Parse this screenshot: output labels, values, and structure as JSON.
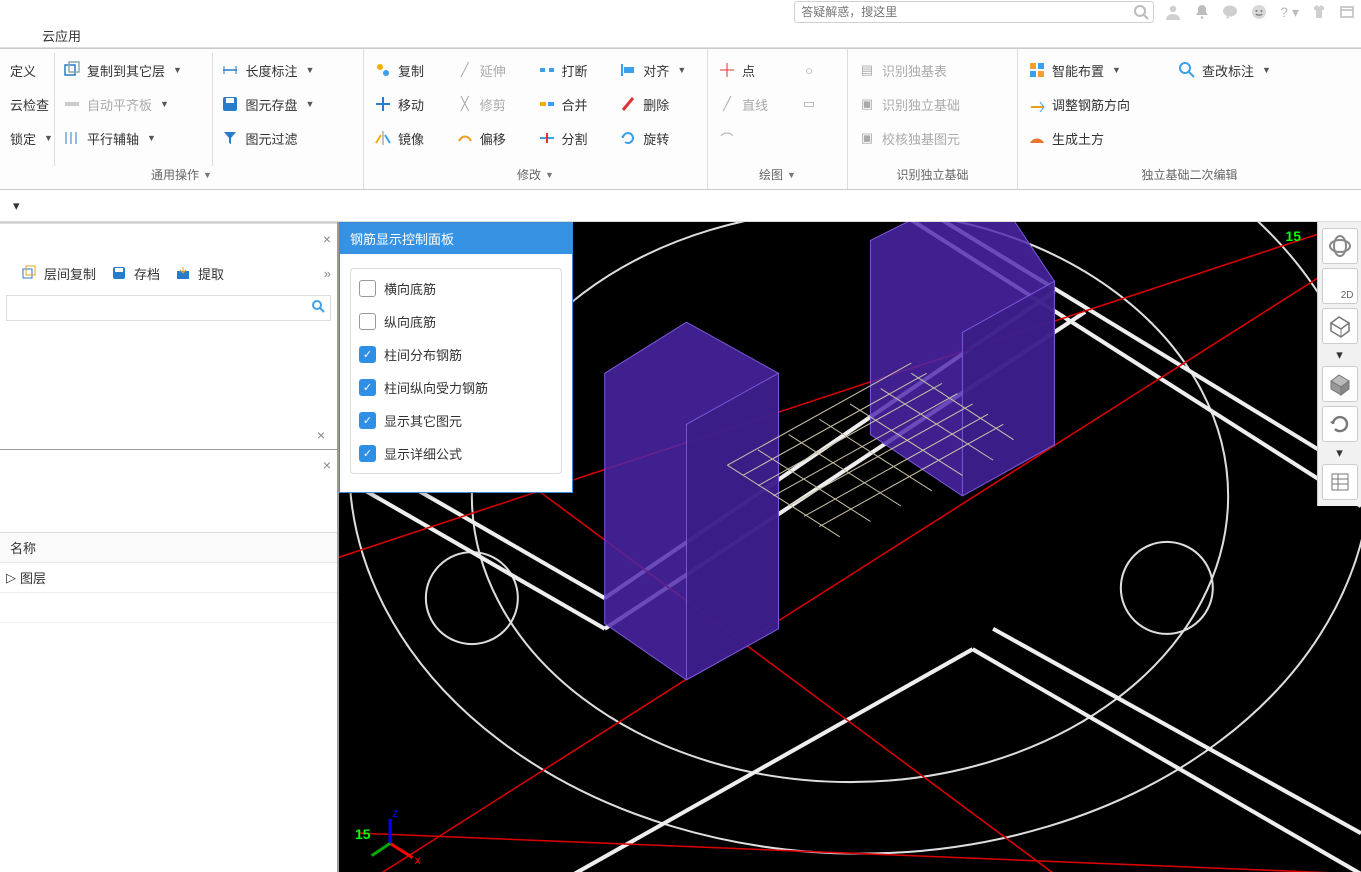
{
  "tab": "云应用",
  "search": {
    "placeholder": "答疑解惑，搜这里"
  },
  "ribbon": {
    "group_general_title": "通用操作",
    "group_modify_title": "修改",
    "group_draw_title": "绘图",
    "group_recog_title": "识别独立基础",
    "group_foundation_title": "独立基础二次编辑",
    "col1": {
      "a": "定义",
      "b": "云检查",
      "c": "锁定"
    },
    "col2": {
      "a": "复制到其它层",
      "b": "自动平齐板",
      "c": "平行辅轴"
    },
    "col3": {
      "a": "长度标注",
      "b": "图元存盘",
      "c": "图元过滤"
    },
    "mod1": {
      "a": "复制",
      "b": "移动",
      "c": "镜像"
    },
    "mod2": {
      "a": "延伸",
      "b": "修剪",
      "c": "偏移"
    },
    "mod3": {
      "a": "打断",
      "b": "合并",
      "c": "分割"
    },
    "mod4": {
      "a": "对齐",
      "b": "删除",
      "c": "旋转"
    },
    "draw": {
      "a": "点",
      "b": "直线"
    },
    "recog": {
      "a": "识别独基表",
      "b": "识别独立基础",
      "c": "校核独基图元"
    },
    "found": {
      "a": "智能布置",
      "b": "调整钢筋方向",
      "c": "生成土方",
      "d": "查改标注"
    }
  },
  "leftpane": {
    "tools": {
      "a": "层间复制",
      "b": "存档",
      "c": "提取"
    },
    "grid": {
      "header": "名称",
      "row1": "图层",
      "row2": ""
    }
  },
  "floatPanel": {
    "title": "钢筋显示控制面板",
    "items": [
      {
        "label": "横向底筋",
        "on": false
      },
      {
        "label": "纵向底筋",
        "on": false
      },
      {
        "label": "柱间分布钢筋",
        "on": true
      },
      {
        "label": "柱间纵向受力钢筋",
        "on": true
      },
      {
        "label": "显示其它图元",
        "on": true
      },
      {
        "label": "显示详细公式",
        "on": true
      }
    ]
  },
  "axis": {
    "a": "15",
    "b": "15"
  },
  "dock2d": "2D"
}
